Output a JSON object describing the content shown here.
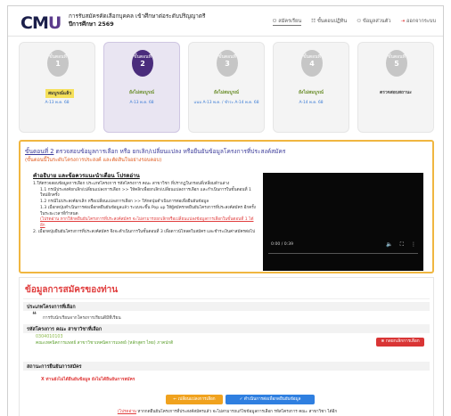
{
  "header": {
    "logo": {
      "text1": "CM",
      "text2": "U",
      "sub": "CHIANG MAI UNIVERSITY"
    },
    "title_line1": "การรับสมัครคัดเลือกบุคคล เข้าศึกษาต่อระดับปริญญาตรี",
    "title_line2": "ปีการศึกษา 2569",
    "nav": [
      {
        "label": "สมัครเรียน",
        "active": true
      },
      {
        "label": "ขั้นตอนปฏิทิน",
        "active": false
      },
      {
        "label": "ข้อมูลส่วนตัว",
        "active": false
      },
      {
        "label": "ออกจากระบบ",
        "active": false,
        "logout": true
      }
    ]
  },
  "steps": [
    {
      "label": "ขั้นตอนที่",
      "number": "1",
      "name": "สมบูรณ์แล้ว",
      "status": "A-13 พ.ค. 68",
      "state": "done"
    },
    {
      "label": "ขั้นตอนที่",
      "number": "2",
      "name": "ยังไม่สมบูรณ์",
      "status": "A-13 พ.ค. 68",
      "state": "current"
    },
    {
      "label": "ขั้นตอนที่",
      "number": "3",
      "name": "ยังไม่สมบูรณ์",
      "status": "แนบ A-13 พ.ค. / ชำระ A-14 พ.ค. 68",
      "state": "pending"
    },
    {
      "label": "ขั้นตอนที่",
      "number": "4",
      "name": "ยังไม่สมบูรณ์",
      "status": "A-14 พ.ค. 68",
      "state": "pending"
    },
    {
      "label": "ขั้นตอนที่",
      "number": "5",
      "name": "ตรวจสอบสถานะ",
      "status": "",
      "state": "pending"
    }
  ],
  "step2": {
    "heading_prefix": "ขั้นตอนที่ 2",
    "heading": "ตรวจสอบข้อมูลการเลือก หรือ ยกเลิก/เปลี่ยนแปลง หรือยืนยันข้อมูลโครงการที่ประสงค์สมัคร",
    "subheading": "(ขั้นตอนนี้ในระดับโครงการประสงค์ และตัดสินใจอย่างรอบคอบ)",
    "explain_title": "คำอธิบาย และข้อควรแนะนำเตือน โปรดอ่าน",
    "instructions": [
      {
        "text": "1.ให้ตรวจสอบข้อมูลการเลือก ประเภทโครงการ รหัสโครงการ คณะ สาขาวิชา ที่ปรากฏในกรอบสี่เหลี่ยมด้านล่าง",
        "indent": false
      },
      {
        "text": "1.1 กรณีประสงค์ยกเลิก/เปลี่ยนแปลงการเลือก >> ให้คลิกเพื่อยกเลิก/เปลี่ยนแปลงการเลือก และกำเนินการในขั้นตอนที่ 1 ใหม่อีกครั้ง",
        "indent": true
      },
      {
        "text": "1.2 กรณีไม่ประสงค์ยกเลิก หรือเปลี่ยนแปลงการเลือก >> ให้กดปุ่มดำเนินการต่อเพื่อยืนยันข้อมูล",
        "indent": true
      },
      {
        "text": "1.3 เมื่อกดปุ่มดำเนินการต่อเพื่อกดยืนยันข้อมูลแล้ว ระบบจะขึ้น Pop up ให้ผู้สมัครกดยืนยันโครงการที่ประสงค์สมัคร อีกครั้ง ในระยะเวลาที่กำหนด",
        "indent": true
      },
      {
        "text": "(โปรดอ่าน หากให้กดยืนยันโครงการที่ประสงค์สมัคร จะไม่สามารถยกเลิกหรือเปลี่ยนแปลงข้อมูลการเลือกในขั้นตอนที่ 1 ได้อีก",
        "indent": true,
        "red": true
      },
      {
        "text": "2. เมื่อกดปุ่มยืนยันโครงการที่ประสงค์สมัคร จึงจะดำเนินการในขั้นตอนที่ 3 เพื่อดาวน์โหลดใบสมัคร และชำระเงินค่าสมัครต่อไป",
        "indent": false
      }
    ],
    "video": {
      "time": "0:00 / 0:39"
    }
  },
  "form": {
    "title": "ข้อมูลการสมัครของท่าน",
    "section1": "ประเภทโครงการที่เลือก",
    "project_type": "การรับนักเรียนจากโครงการเรียนดีมีที่เรียน",
    "section2": "รหัสโครงการ คณะ สาขาวิชาที่เลือก",
    "program_code": "0304010103",
    "program_name": "คณะเทคนิคการแพทย์ สาขาวิชาเทคนิคการแพทย์ (หลักสูตร ไทย) ภาคปกติ",
    "cancel_button": "กดยกเลิกการเลือก",
    "section3": "สถานะการยืนยันการสมัคร",
    "status_text": "X ท่านยังไม่ได้ยืนยันข้อมูล ยังไม่ได้ยืนยันการสมัคร",
    "back_button": "← เปลี่ยนแปลงการเลือก",
    "confirm_button": "✓ ดำเนินการต่อเพื่อกดยืนยันข้อมูล",
    "note_prefix": "(โปรดอ่าน",
    "note_text": "หากกดยืนยันโครงการที่ประสงค์สมัครแล้ว จะไม่สามารถแก้ไขข้อมูลการเลือก รหัสโครงการ คณะ สาขาวิชา ได้อีก"
  },
  "colors": {
    "primary_purple": "#4a2c7c",
    "accent_red": "#e03c3c",
    "accent_orange": "#f0a21e",
    "accent_blue": "#2f7fe0",
    "accent_green": "#5a9e2a",
    "border_yellow": "#f0b640"
  }
}
